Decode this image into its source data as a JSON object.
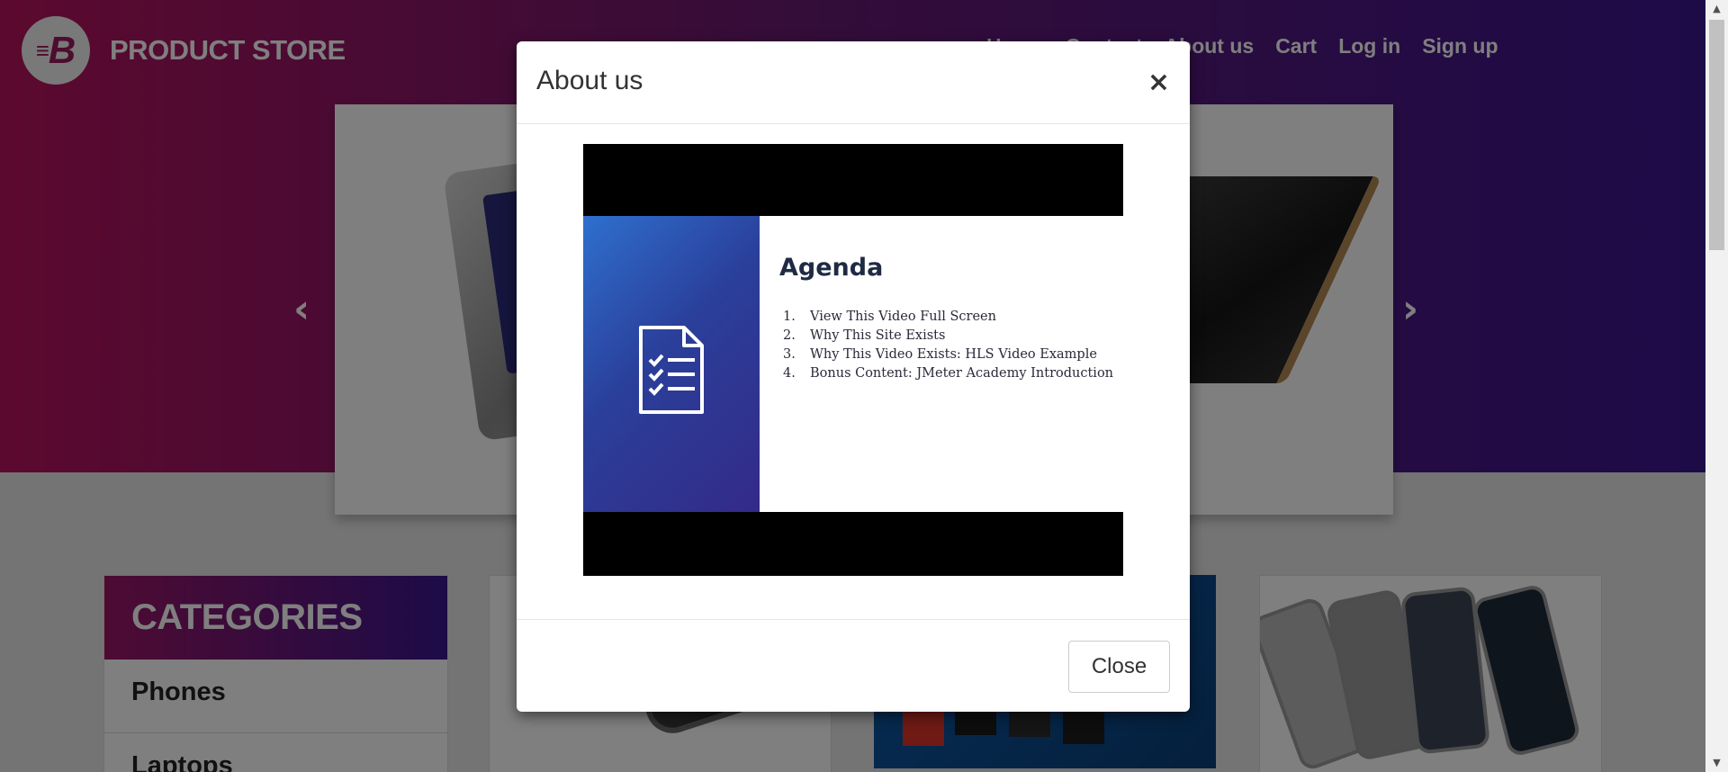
{
  "brand": {
    "name": "PRODUCT STORE",
    "logo_letter": "B"
  },
  "nav": {
    "items": [
      {
        "label": "Home"
      },
      {
        "label": "Contact"
      },
      {
        "label": "About us"
      },
      {
        "label": "Cart"
      },
      {
        "label": "Log in"
      },
      {
        "label": "Sign up"
      }
    ]
  },
  "carousel": {
    "prev_icon": "‹",
    "next_icon": "›"
  },
  "categories": {
    "title": "CATEGORIES",
    "items": [
      {
        "label": "Phones"
      },
      {
        "label": "Laptops"
      }
    ]
  },
  "modal": {
    "title": "About us",
    "close_icon": "×",
    "close_label": "Close",
    "video": {
      "slide_title": "Agenda",
      "items": [
        {
          "num": "1.",
          "text": "View This Video Full Screen"
        },
        {
          "num": "2.",
          "text": "Why This Site Exists"
        },
        {
          "num": "3.",
          "text": "Why This Video Exists: HLS Video Example"
        },
        {
          "num": "4.",
          "text": "Bonus Content: JMeter Academy Introduction"
        }
      ]
    }
  },
  "scrollbar": {
    "up_icon": "▲",
    "down_icon": "▼"
  },
  "icons": {
    "logo": "b-logo-icon",
    "document": "checklist-document-icon"
  },
  "colors": {
    "gradient_start": "#b8125e",
    "gradient_end": "#3a1690",
    "backdrop": "rgba(0,0,0,0.5)"
  }
}
